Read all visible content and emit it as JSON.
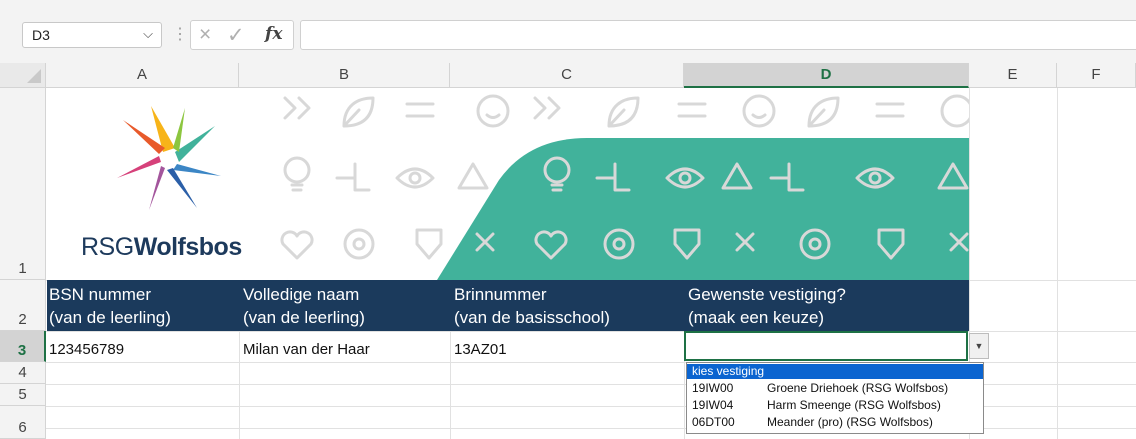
{
  "formula_bar": {
    "name_box": "D3",
    "cancel_icon": "×",
    "enter_icon": "✓",
    "function_icon": "fx",
    "formula": ""
  },
  "columns": [
    "A",
    "B",
    "C",
    "D",
    "E",
    "F"
  ],
  "rows": [
    "1",
    "2",
    "3",
    "4",
    "5",
    "6"
  ],
  "selected_column": "D",
  "selected_row": "3",
  "banner": {
    "logo_prefix": "RSG",
    "logo_name": "Wolfsbos",
    "band_color": "#41b29b",
    "header_color": "#1b3a5c"
  },
  "header_row": [
    {
      "line1": "BSN nummer",
      "line2": "(van de leerling)"
    },
    {
      "line1": "Volledige naam",
      "line2": "(van de leerling)"
    },
    {
      "line1": "Brinnummer",
      "line2": "(van de basisschool)"
    },
    {
      "line1": "Gewenste vestiging?",
      "line2": "(maak een keuze)"
    }
  ],
  "data_row": {
    "a": "123456789",
    "b": "Milan van der Haar",
    "c": "13AZ01",
    "d": ""
  },
  "dropdown": {
    "placeholder": "kies vestiging",
    "options": [
      {
        "code": "19IW00",
        "name": "Groene Driehoek (RSG Wolfsbos)"
      },
      {
        "code": "19IW04",
        "name": "Harm Smeenge (RSG Wolfsbos)"
      },
      {
        "code": "06DT00",
        "name": "Meander (pro) (RSG Wolfsbos)"
      }
    ]
  }
}
